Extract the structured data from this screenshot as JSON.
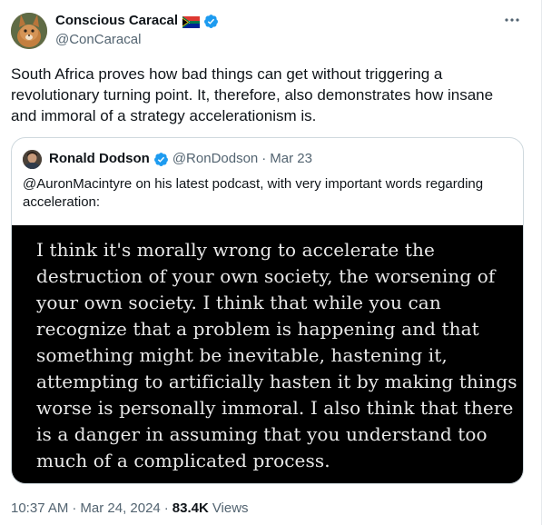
{
  "author": {
    "name": "Conscious Caracal",
    "handle": "@ConCaracal",
    "flag_icon": "south-africa-flag",
    "verified_icon": "verified-badge-icon",
    "verified_color": "#1d9bf0"
  },
  "tweet": {
    "text": "South Africa proves how bad things can get without triggering a\nrevolutionary turning point. It, therefore, also demonstrates how insane\nand immoral of a strategy accelerationism is."
  },
  "quote": {
    "author_name": "Ronald Dodson",
    "author_handle": "@RonDodson",
    "separator": "·",
    "date": "Mar 23",
    "text": "@AuronMacintyre on his latest podcast, with very important words regarding acceleration:",
    "image_text": "I think it's morally wrong to accelerate the destruction of your own society, the worsening of your own society. I think that while you can recognize that a problem is happening and that something might be inevitable, hastening it, attempting to artificially hasten it by making things worse is personally immoral. I also think that there is a danger in assuming that you understand too much of a complicated process."
  },
  "meta": {
    "time": "10:37 AM",
    "separator": "·",
    "date": "Mar 24, 2024",
    "separator2": "·",
    "views_count": "83.4K",
    "views_label": "Views"
  },
  "colors": {
    "text_primary": "#0f1419",
    "text_secondary": "#536471",
    "border": "#cfd9de",
    "image_background": "#000000"
  }
}
